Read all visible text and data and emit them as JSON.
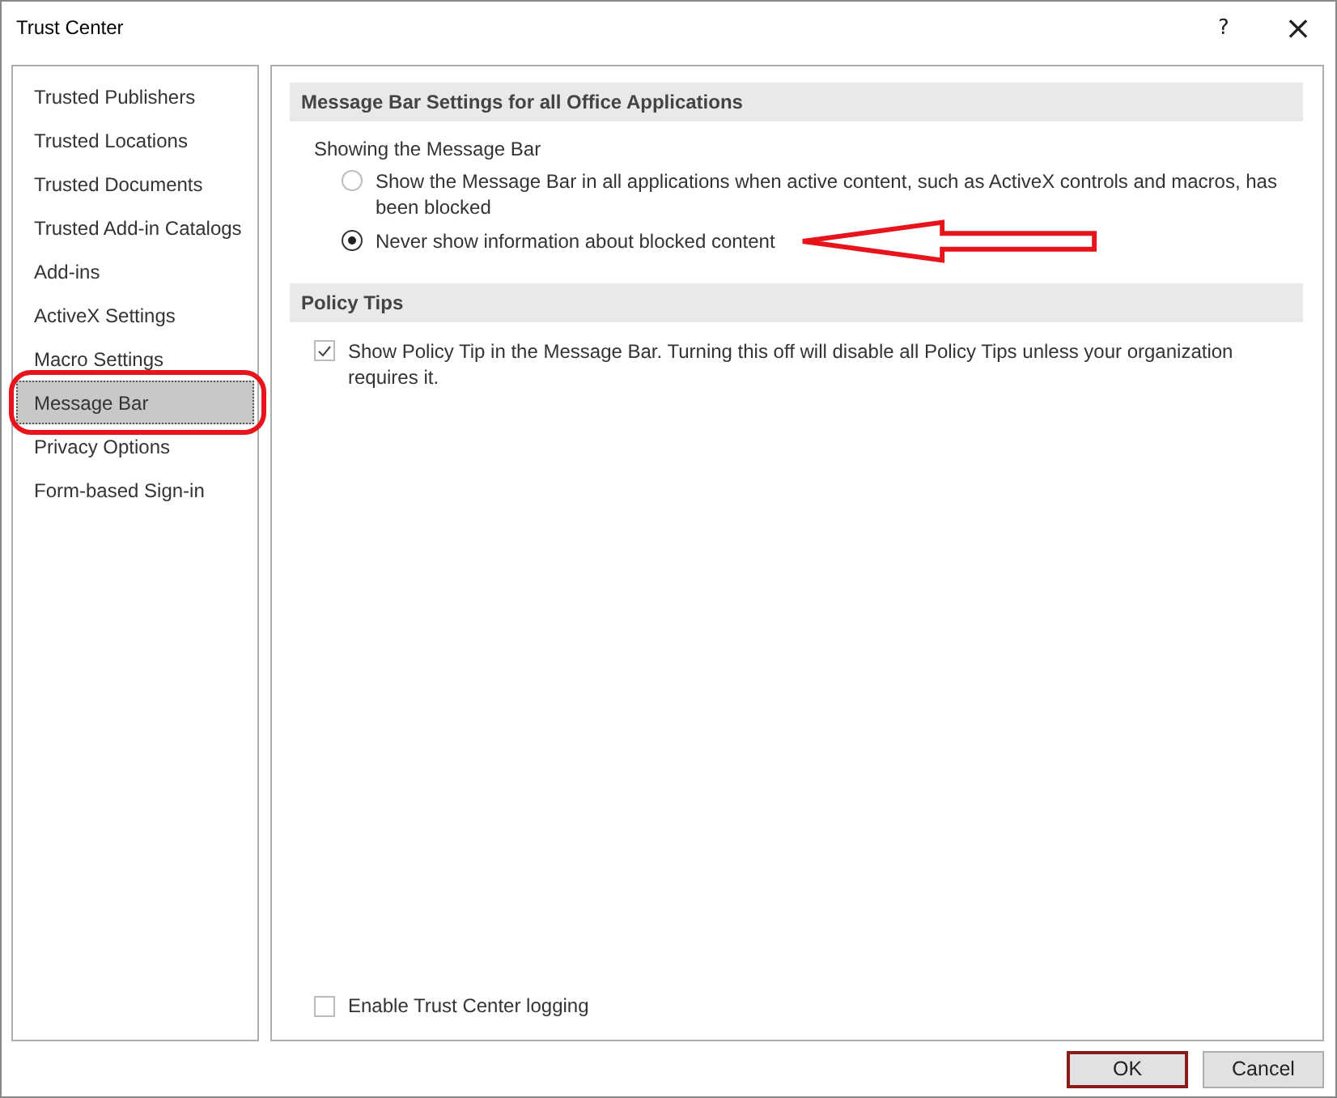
{
  "window": {
    "title": "Trust Center",
    "help": "?",
    "close": "×"
  },
  "sidebar": {
    "items": [
      {
        "label": "Trusted Publishers",
        "selected": false,
        "circled": false
      },
      {
        "label": "Trusted Locations",
        "selected": false,
        "circled": false
      },
      {
        "label": "Trusted Documents",
        "selected": false,
        "circled": false
      },
      {
        "label": "Trusted Add-in Catalogs",
        "selected": false,
        "circled": false
      },
      {
        "label": "Add-ins",
        "selected": false,
        "circled": false
      },
      {
        "label": "ActiveX Settings",
        "selected": false,
        "circled": false
      },
      {
        "label": "Macro Settings",
        "selected": false,
        "circled": false
      },
      {
        "label": "Message Bar",
        "selected": true,
        "circled": true
      },
      {
        "label": "Privacy Options",
        "selected": false,
        "circled": false
      },
      {
        "label": "Form-based Sign-in",
        "selected": false,
        "circled": false
      }
    ]
  },
  "sections": [
    {
      "title": "Message Bar Settings for all Office Applications",
      "group_label": "Showing the Message Bar",
      "items": [
        {
          "kind": "radio",
          "label": "Show the Message Bar in all applications when active content, such as ActiveX controls and macros, has been blocked",
          "selected": false,
          "arrow": false
        },
        {
          "kind": "radio",
          "label": "Never show information about blocked content",
          "selected": true,
          "arrow": true
        }
      ]
    },
    {
      "title": "Policy Tips",
      "items": [
        {
          "kind": "checkbox",
          "label": "Show Policy Tip in the Message Bar. Turning this off will disable all Policy Tips unless your organization requires it.",
          "checked": true
        }
      ]
    }
  ],
  "logging": {
    "label": "Enable Trust Center logging",
    "checked": false
  },
  "buttons": [
    {
      "label": "OK",
      "default": true
    },
    {
      "label": "Cancel",
      "default": false
    }
  ]
}
